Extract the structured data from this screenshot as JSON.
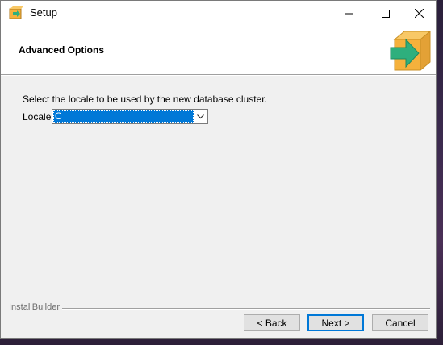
{
  "window": {
    "title": "Setup",
    "minimize_icon": "minimize-icon",
    "maximize_icon": "maximize-icon",
    "close_icon": "close-icon"
  },
  "header": {
    "title": "Advanced Options",
    "logo_icon": "installer-box-arrow-icon"
  },
  "main": {
    "prompt": "Select the locale to be used by the new database cluster.",
    "locale_label": "Locale",
    "locale_value": "C"
  },
  "footer": {
    "installbuilder_label": "InstallBuilder",
    "back_label": "< Back",
    "next_label": "Next >",
    "cancel_label": "Cancel"
  },
  "colors": {
    "selection": "#0078d7",
    "logo_orange": "#f5b13c",
    "logo_arrow": "#2eaf7d"
  }
}
